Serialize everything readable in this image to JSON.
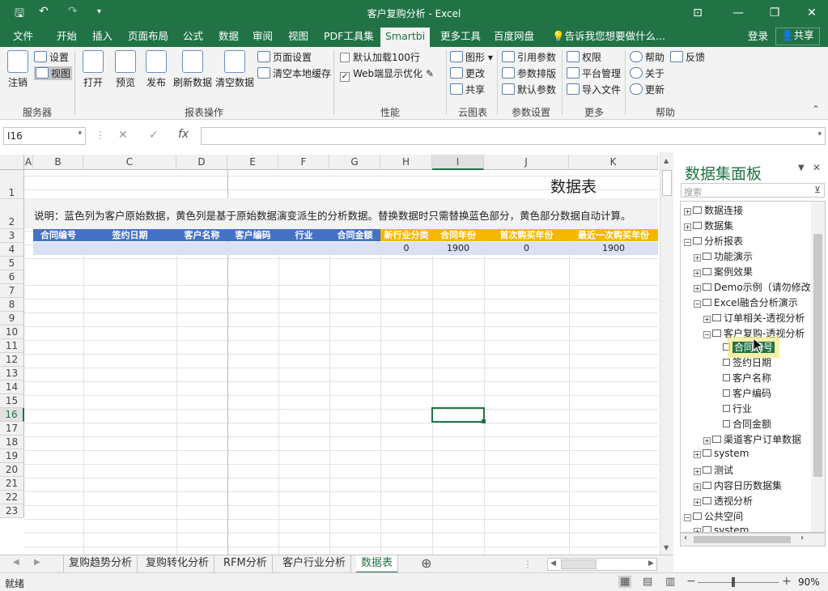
{
  "titlebar": {
    "title": "客户复购分析 - Excel",
    "save_icon": "floppy-icon",
    "min": "—",
    "restore": "❐",
    "close": "✕"
  },
  "tabs": [
    {
      "label": "文件"
    },
    {
      "label": "开始"
    },
    {
      "label": "插入"
    },
    {
      "label": "页面布局"
    },
    {
      "label": "公式"
    },
    {
      "label": "数据"
    },
    {
      "label": "审阅"
    },
    {
      "label": "视图"
    },
    {
      "label": "PDF工具集"
    },
    {
      "label": "Smartbi"
    },
    {
      "label": "更多工具"
    },
    {
      "label": "百度网盘"
    }
  ],
  "tell_me": "告诉我您想要做什么...",
  "login": "登录",
  "share": "共享",
  "ribbon": {
    "logout": "注销",
    "settings": "设置",
    "view": "视图",
    "open": "打开",
    "preview": "预览",
    "publish": "发布",
    "refresh": "刷新数据",
    "clear": "清空数据",
    "page_setup": "页面设置",
    "clear_cache": "清空本地缓存",
    "load100": "默认加载100行",
    "web_opt": "Web端显示优化",
    "chart": "图形",
    "change": "更改",
    "share": "共享",
    "ref_param": "引用参数",
    "param_layout": "参数排版",
    "default_param": "默认参数",
    "perm": "权限",
    "platform": "平台管理",
    "import": "导入文件",
    "help": "帮助",
    "feedback": "反馈",
    "about": "关于",
    "update": "更新",
    "groups": {
      "service": "服务器",
      "report": "报表操作",
      "perf": "性能",
      "cloud": "云图表",
      "param": "参数设置",
      "more": "更多",
      "help": "帮助"
    }
  },
  "namebox": "I16",
  "fx": "fx",
  "columns": [
    "A",
    "B",
    "C",
    "D",
    "E",
    "F",
    "G",
    "H",
    "I",
    "J",
    "K"
  ],
  "rows": [
    "1",
    "2",
    "3",
    "4",
    "5",
    "6",
    "7",
    "8",
    "9",
    "10",
    "11",
    "12",
    "13",
    "14",
    "15",
    "16",
    "17",
    "18",
    "19",
    "20",
    "21",
    "22",
    "23"
  ],
  "sheet": {
    "title": "数据表",
    "note": "说明：蓝色列为客户原始数据，黄色列是基于原始数据演变派生的分析数据。替换数据时只需替换蓝色部分，黄色部分数据自动计算。",
    "headers_blue": [
      "合同编号",
      "签约日期",
      "客户名称",
      "客户编码",
      "行业",
      "合同金额"
    ],
    "headers_yellow": [
      "新行业分类",
      "合同年份",
      "首次购买年份",
      "最近一次购买年份"
    ],
    "row4": [
      "0",
      "1900",
      "0",
      "1900"
    ]
  },
  "panel": {
    "title": "数据集面板",
    "search_placeholder": "搜索",
    "tree": [
      "数据连接",
      "数据集",
      "分析报表",
      "功能演示",
      "案例效果",
      "Demo示例（请勿修改）",
      "Excel融合分析演示",
      "订单相关-透视分析",
      "客户复购-透视分析",
      "合同编号",
      "签约日期",
      "客户名称",
      "客户编码",
      "行业",
      "合同金额",
      "渠道客户订单数据",
      "system",
      "测试",
      "内容日历数据集",
      "透视分析",
      "公共空间",
      "system"
    ]
  },
  "sheet_tabs": [
    "复购趋势分析",
    "复购转化分析",
    "RFM分析",
    "客户行业分析",
    "数据表"
  ],
  "status": {
    "ready": "就绪",
    "zoom": "90%"
  }
}
